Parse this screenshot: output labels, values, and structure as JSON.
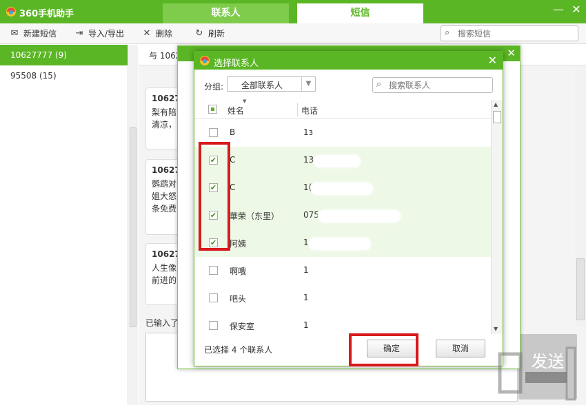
{
  "app": {
    "title": "360手机助手",
    "minimize": "—",
    "close": "✕"
  },
  "tabs": [
    {
      "label": "联系人"
    },
    {
      "label": "短信"
    }
  ],
  "toolbar": {
    "new_sms": "新建短信",
    "import_export": "导入/导出",
    "delete": "删除",
    "refresh": "刷新",
    "search_placeholder": "搜索短信"
  },
  "sidebar": {
    "items": [
      {
        "label": "10627777 (9)"
      },
      {
        "label": "95508 (15)"
      }
    ]
  },
  "conversation": {
    "header_prefix": "与 1062",
    "messages": [
      {
        "sender": "10627",
        "text": "梨有陪清凉，"
      },
      {
        "sender": "10627",
        "text": "鹦鹉对姐大怒条免费"
      },
      {
        "sender": "10627",
        "text": "人生像前进的"
      }
    ],
    "typed_label": "已输入了",
    "send_label": "发送"
  },
  "dialog": {
    "title": "选择联系人",
    "close": "✕",
    "group_label": "分组:",
    "group_value": "全部联系人",
    "search_placeholder": "搜索联系人",
    "col_name": "姓名",
    "col_phone": "电话",
    "contacts": [
      {
        "name": "B",
        "phone": "1з",
        "checked": false
      },
      {
        "name": "C",
        "phone": "13",
        "checked": true
      },
      {
        "name": "C",
        "phone": "1(",
        "checked": true
      },
      {
        "name": "華荣（东里）",
        "phone": "075",
        "checked": true
      },
      {
        "name": "阿姨",
        "phone": "1",
        "checked": true
      },
      {
        "name": "啊哦",
        "phone": "1",
        "checked": false
      },
      {
        "name": "吧头",
        "phone": "1",
        "checked": false
      },
      {
        "name": "保安室",
        "phone": "1",
        "checked": false
      }
    ],
    "selected_count_text": "已选择 4 个联系人",
    "ok_label": "确定",
    "cancel_label": "取消"
  },
  "colors": {
    "brand_green": "#5bb625",
    "highlight_red": "#d81a1a",
    "selected_row": "#eef8e6"
  }
}
